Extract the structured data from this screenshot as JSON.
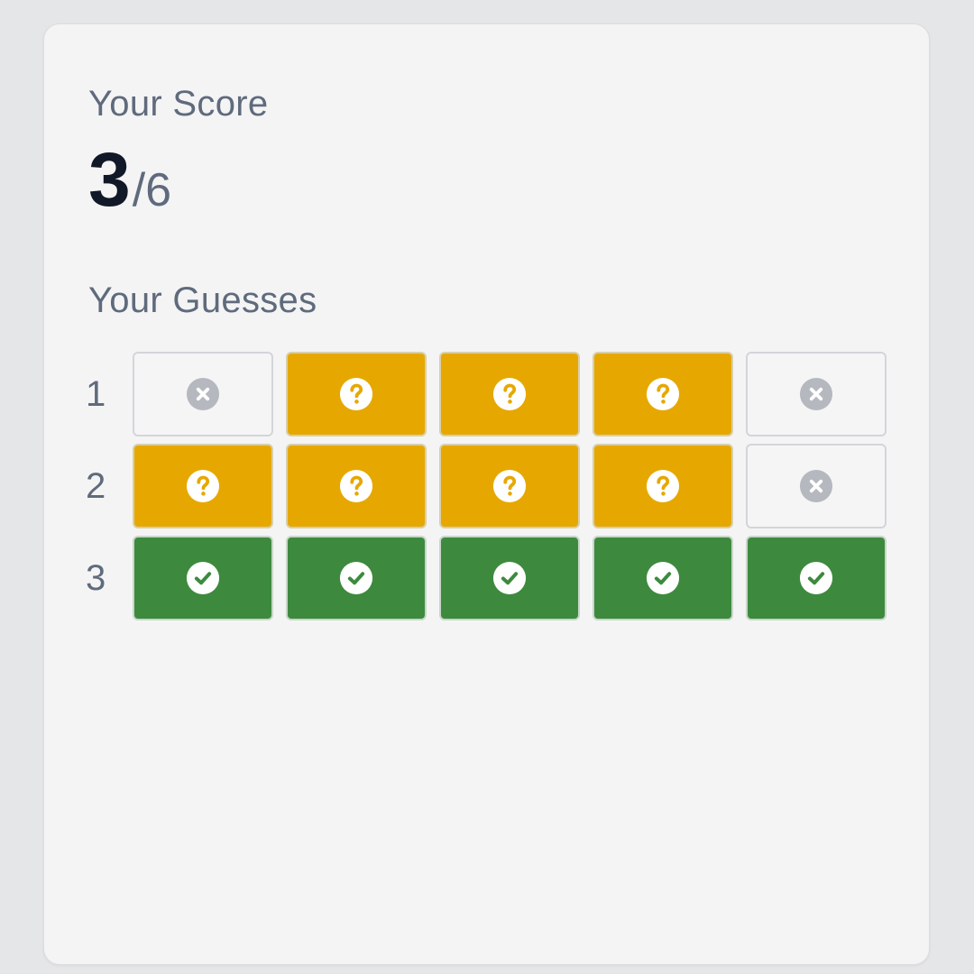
{
  "score": {
    "label": "Your Score",
    "value": "3",
    "total": "/6"
  },
  "guesses": {
    "label": "Your Guesses",
    "rows": [
      {
        "number": "1",
        "cells": [
          "absent",
          "present",
          "present",
          "present",
          "absent"
        ]
      },
      {
        "number": "2",
        "cells": [
          "present",
          "present",
          "present",
          "present",
          "absent"
        ]
      },
      {
        "number": "3",
        "cells": [
          "correct",
          "correct",
          "correct",
          "correct",
          "correct"
        ]
      }
    ]
  },
  "icons": {
    "absent": "x-circle-icon",
    "present": "question-circle-icon",
    "correct": "check-circle-icon"
  },
  "colors": {
    "absent": "#f5f5f6",
    "present": "#e6a800",
    "correct": "#3d8a3e",
    "absent_icon": "#b5b8be",
    "present_icon": "#ffffff",
    "correct_icon": "#ffffff"
  }
}
